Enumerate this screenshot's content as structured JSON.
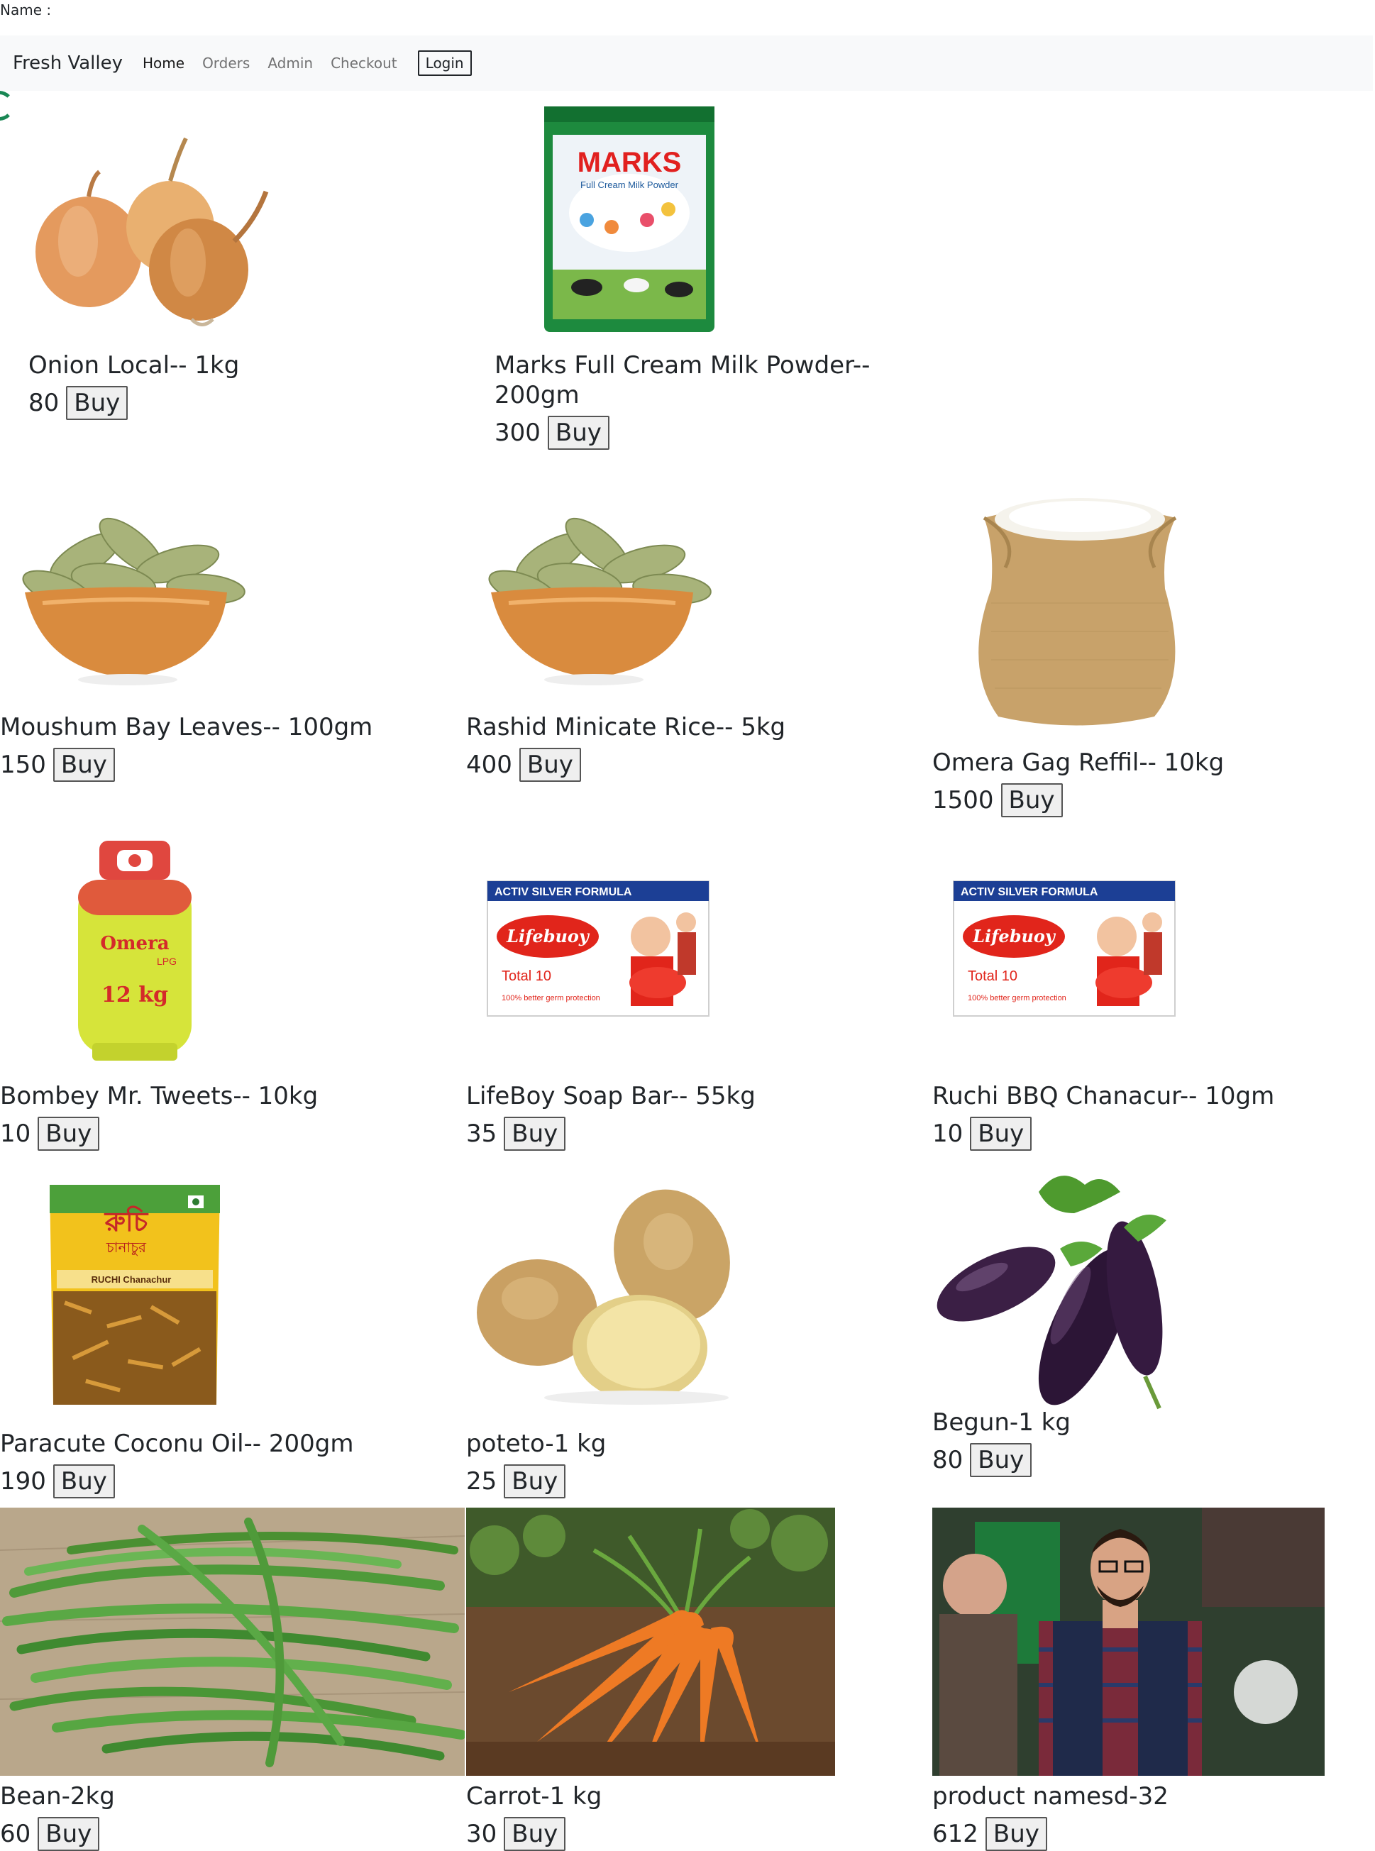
{
  "header": {
    "name_label": "Name :"
  },
  "navbar": {
    "brand": "Fresh Valley",
    "links": [
      "Home",
      "Orders",
      "Admin",
      "Checkout"
    ],
    "login_label": "Login"
  },
  "buy_label": "Buy",
  "products": [
    {
      "name": "Onion Local-- 1kg",
      "price": "80",
      "image": "onion-image"
    },
    {
      "name": "Marks Full Cream Milk Powder-- 200gm",
      "price": "300",
      "image": "milk-powder-packet-image",
      "brand_text": "MARKS",
      "sub_text": "Full Cream Milk Powder"
    },
    {
      "name": "Moushum Bay Leaves-- 100gm",
      "price": "150",
      "image": "bay-leaves-bowl-image"
    },
    {
      "name": "Rashid Minicate Rice-- 5kg",
      "price": "400",
      "image": "bay-leaves-bowl-image"
    },
    {
      "name": "Omera Gag Reffil-- 10kg",
      "price": "1500",
      "image": "rice-sack-image"
    },
    {
      "name": "Bombey Mr. Tweets-- 10kg",
      "price": "10",
      "image": "gas-cylinder-image",
      "brand_text": "Omera",
      "sub_text": "LPG",
      "extra_text": "12 kg"
    },
    {
      "name": "LifeBoy Soap Bar-- 55kg",
      "price": "35",
      "image": "soap-box-image",
      "banner": "ACTIV SILVER FORMULA",
      "brand_text": "Lifebuoy",
      "sub_text": "Total 10",
      "extra_text": "100% better germ protection"
    },
    {
      "name": "Ruchi BBQ Chanacur-- 10gm",
      "price": "10",
      "image": "soap-box-image",
      "banner": "ACTIV SILVER FORMULA",
      "brand_text": "Lifebuoy",
      "sub_text": "Total 10",
      "extra_text": "100% better germ protection"
    },
    {
      "name": "Paracute Coconu Oil-- 200gm",
      "price": "190",
      "image": "chanachur-packet-image",
      "brand_text": "রুচি",
      "sub_text": "চানাচুর",
      "extra_text": "RUCHI Chanachur"
    },
    {
      "name": "poteto-1 kg",
      "price": "25",
      "image": "potato-image"
    },
    {
      "name": "Begun-1 kg",
      "price": "80",
      "image": "eggplant-image"
    },
    {
      "name": "Bean-2kg",
      "price": "60",
      "image": "green-beans-image"
    },
    {
      "name": "Carrot-1 kg",
      "price": "30",
      "image": "carrot-image"
    },
    {
      "name": "product namesd-32",
      "price": "612",
      "image": "person-photo-image"
    }
  ]
}
